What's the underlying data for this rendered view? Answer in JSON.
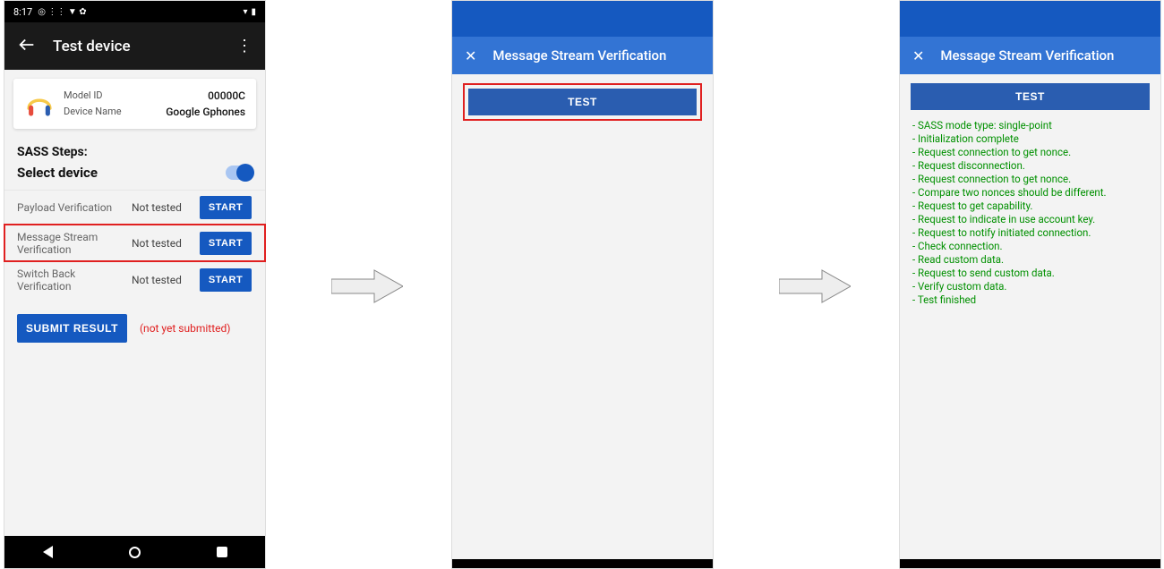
{
  "statusbar": {
    "time": "8:17",
    "glyphs": "◎  ⋮⋮  ▼  ✿",
    "signal": "▾",
    "battery": "▮"
  },
  "appbar": {
    "title": "Test device"
  },
  "card": {
    "model_label": "Model ID",
    "model_value": "00000C",
    "device_label": "Device Name",
    "device_value": "Google Gphones"
  },
  "sass_label": "SASS Steps:",
  "select_label": "Select device",
  "rows": [
    {
      "name": "Payload Verification",
      "status": "Not tested",
      "btn": "START"
    },
    {
      "name": "Message Stream Verification",
      "status": "Not tested",
      "btn": "START"
    },
    {
      "name": "Switch Back Verification",
      "status": "Not tested",
      "btn": "START"
    }
  ],
  "submit": {
    "label": "SUBMIT RESULT",
    "note": "(not yet submitted)"
  },
  "screen2": {
    "title": "Message Stream Verification",
    "test_btn": "TEST"
  },
  "screen3": {
    "title": "Message Stream Verification",
    "test_btn": "TEST",
    "log": [
      "SASS mode type: single-point",
      "Initialization complete",
      "Request connection to get nonce.",
      "Request disconnection.",
      "Request connection to get nonce.",
      "Compare two nonces should be different.",
      "Request to get capability.",
      "Request to indicate in use account key.",
      "Request to notify initiated connection.",
      "Check connection.",
      "Read custom data.",
      "Request to send custom data.",
      "Verify custom data.",
      "Test finished"
    ]
  }
}
